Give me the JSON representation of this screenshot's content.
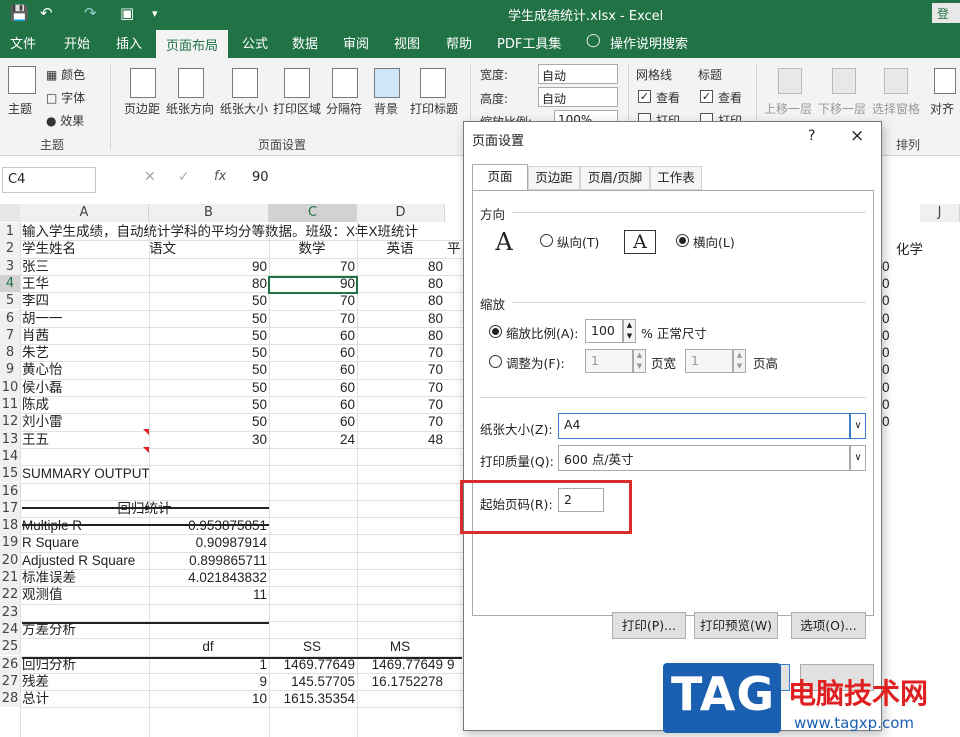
{
  "titlebar": {
    "title": "学生成绩统计.xlsx  -  Excel",
    "login": "登录"
  },
  "tabs": [
    "文件",
    "开始",
    "插入",
    "页面布局",
    "公式",
    "数据",
    "审阅",
    "视图",
    "帮助",
    "PDF工具集",
    "操作说明搜索"
  ],
  "ribbon": {
    "theme": {
      "themes": "主题",
      "colors": "颜色",
      "fonts": "字体",
      "effects": "效果",
      "group": "主题"
    },
    "page_setup": {
      "margins": "页边距",
      "orientation": "纸张方向",
      "size": "纸张大小",
      "print_area": "打印区域",
      "breaks": "分隔符",
      "background": "背景",
      "print_titles": "打印标题",
      "group": "页面设置"
    },
    "scale": {
      "width_label": "宽度:",
      "width_value": "自动",
      "height_label": "高度:",
      "height_value": "自动",
      "scale_label": "缩放比例:",
      "scale_value": "100%"
    },
    "sheet_options": {
      "gridlines": "网格线",
      "headings": "标题",
      "view": "查看",
      "print": "打印"
    },
    "arrange": {
      "bring_forward": "上移一层",
      "send_backward": "下移一层",
      "selection_pane": "选择窗格",
      "align": "对齐",
      "group": "排列"
    }
  },
  "formula_bar": {
    "name_box": "C4",
    "fx": "fx",
    "value": "90"
  },
  "columns": [
    "A",
    "B",
    "C",
    "D",
    "J"
  ],
  "rows": [
    {
      "n": "1",
      "a": "输入学生成绩，自动统计学科的平均分等数据。班级：X年X班统计",
      "b": "",
      "c": "",
      "d": ""
    },
    {
      "n": "2",
      "a": "学生姓名",
      "b": "语文",
      "c": "数学",
      "d": "英语",
      "e": "平"
    },
    {
      "n": "3",
      "a": "张三",
      "b": "90",
      "c": "70",
      "d": "80"
    },
    {
      "n": "4",
      "a": "王华",
      "b": "80",
      "c": "90",
      "d": "80"
    },
    {
      "n": "5",
      "a": "李四",
      "b": "50",
      "c": "70",
      "d": "80"
    },
    {
      "n": "6",
      "a": "胡一一",
      "b": "50",
      "c": "70",
      "d": "80"
    },
    {
      "n": "7",
      "a": "肖茜",
      "b": "50",
      "c": "60",
      "d": "80"
    },
    {
      "n": "8",
      "a": "朱艺",
      "b": "50",
      "c": "60",
      "d": "70"
    },
    {
      "n": "9",
      "a": "黄心怡",
      "b": "50",
      "c": "60",
      "d": "70"
    },
    {
      "n": "10",
      "a": "侯小磊",
      "b": "50",
      "c": "60",
      "d": "70"
    },
    {
      "n": "11",
      "a": "陈成",
      "b": "50",
      "c": "60",
      "d": "70"
    },
    {
      "n": "12",
      "a": "刘小雷",
      "b": "50",
      "c": "60",
      "d": "70"
    },
    {
      "n": "13",
      "a": "王五",
      "b": "30",
      "c": "24",
      "d": "48"
    },
    {
      "n": "14",
      "a": "",
      "b": "",
      "c": "",
      "d": ""
    },
    {
      "n": "15",
      "a": "SUMMARY OUTPUT",
      "b": "",
      "c": "",
      "d": ""
    },
    {
      "n": "16",
      "a": "",
      "b": "",
      "c": "",
      "d": ""
    },
    {
      "n": "17",
      "a": "回归统计",
      "b": "",
      "c": "",
      "d": ""
    },
    {
      "n": "18",
      "a": "Multiple R",
      "b": "0.953875851",
      "c": "",
      "d": ""
    },
    {
      "n": "19",
      "a": "R Square",
      "b": "0.90987914",
      "c": "",
      "d": ""
    },
    {
      "n": "20",
      "a": "Adjusted R Square",
      "b": "0.899865711",
      "c": "",
      "d": ""
    },
    {
      "n": "21",
      "a": "标准误差",
      "b": "4.021843832",
      "c": "",
      "d": ""
    },
    {
      "n": "22",
      "a": "观测值",
      "b": "11",
      "c": "",
      "d": ""
    },
    {
      "n": "23",
      "a": "",
      "b": "",
      "c": "",
      "d": ""
    },
    {
      "n": "24",
      "a": "方差分析",
      "b": "",
      "c": "",
      "d": ""
    },
    {
      "n": "25",
      "a": "",
      "b": "df",
      "c": "SS",
      "d": "MS"
    },
    {
      "n": "26",
      "a": "回归分析",
      "b": "1",
      "c": "1469.77649",
      "d": "1469.77649",
      "e": "9"
    },
    {
      "n": "27",
      "a": "残差",
      "b": "9",
      "c": "145.57705",
      "d": "16.1752278"
    },
    {
      "n": "28",
      "a": "总计",
      "b": "10",
      "c": "1615.35354",
      "d": ""
    }
  ],
  "right_col": {
    "header": "化学",
    "values": [
      "0",
      "0",
      "0",
      "0",
      "0",
      "0",
      "0",
      "0",
      "0",
      "0"
    ]
  },
  "dialog": {
    "title": "页面设置",
    "help": "?",
    "close": "×",
    "tabs": [
      "页面",
      "页边距",
      "页眉/页脚",
      "工作表"
    ],
    "orientation_label": "方向",
    "portrait": "纵向(T)",
    "landscape": "横向(L)",
    "scaling_label": "缩放",
    "adjust_to": "缩放比例(A):",
    "adjust_value": "100",
    "adjust_unit": "% 正常尺寸",
    "fit_to": "调整为(F):",
    "fit_wide": "1",
    "fit_wide_label": "页宽",
    "fit_tall": "1",
    "fit_tall_label": "页高",
    "paper_size_label": "纸张大小(Z):",
    "paper_size": "A4",
    "print_quality_label": "打印质量(Q):",
    "print_quality": "600 点/英寸",
    "first_page_label": "起始页码(R):",
    "first_page": "2",
    "print_btn": "打印(P)...",
    "preview_btn": "打印预览(W)",
    "options_btn": "选项(O)..."
  },
  "watermark": {
    "logo": "TAG",
    "title": "电脑技术网",
    "url": "www.tagxp.com"
  }
}
